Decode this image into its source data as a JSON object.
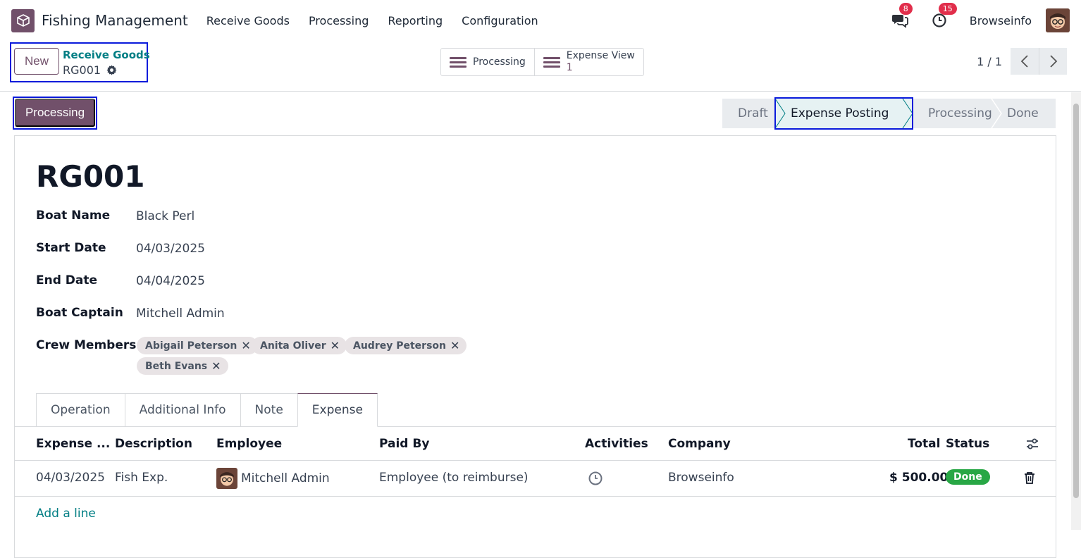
{
  "app": {
    "name": "Fishing Management"
  },
  "menu": [
    "Receive Goods",
    "Processing",
    "Reporting",
    "Configuration"
  ],
  "systray": {
    "messages_count": "8",
    "activities_count": "15",
    "company": "Browseinfo"
  },
  "control": {
    "new_label": "New",
    "breadcrumb_parent": "Receive Goods",
    "breadcrumb_current": "RG001",
    "smart_processing": "Processing",
    "smart_expense_label": "Expense View",
    "smart_expense_count": "1",
    "pager": "1 / 1"
  },
  "status": {
    "action_button": "Processing",
    "stages": [
      "Draft",
      "Expense Posting",
      "Processing",
      "Done"
    ],
    "active_stage": "Expense Posting"
  },
  "record": {
    "title": "RG001",
    "fields": [
      {
        "label": "Boat Name",
        "value": "Black Perl"
      },
      {
        "label": "Start Date",
        "value": "04/03/2025"
      },
      {
        "label": "End Date",
        "value": "04/04/2025"
      },
      {
        "label": "Boat Captain",
        "value": "Mitchell Admin"
      }
    ],
    "crew_label": "Crew Members",
    "crew": [
      "Abigail Peterson",
      "Anita Oliver",
      "Audrey Peterson",
      "Beth Evans"
    ]
  },
  "tabs": [
    "Operation",
    "Additional Info",
    "Note",
    "Expense"
  ],
  "expense_table": {
    "headers": [
      "Expense ...",
      "Description",
      "Employee",
      "Paid By",
      "Activities",
      "Company",
      "Total",
      "Status"
    ],
    "rows": [
      {
        "date": "04/03/2025",
        "description": "Fish Exp.",
        "employee": "Mitchell Admin",
        "paid_by": "Employee (to reimburse)",
        "company": "Browseinfo",
        "total": "$ 500.00",
        "status": "Done"
      }
    ],
    "add_line": "Add a line"
  },
  "colors": {
    "brand": "#71506a",
    "link": "#017e84",
    "highlight": "#0a1bdb",
    "badge": "#e12e4b",
    "done": "#28a745"
  },
  "icons": [
    "app-icon",
    "chat-icon",
    "clock-icon",
    "gear-icon",
    "chevron-left-icon",
    "chevron-right-icon",
    "list-icon",
    "remove-icon",
    "settings-sliders-icon",
    "trash-icon"
  ]
}
